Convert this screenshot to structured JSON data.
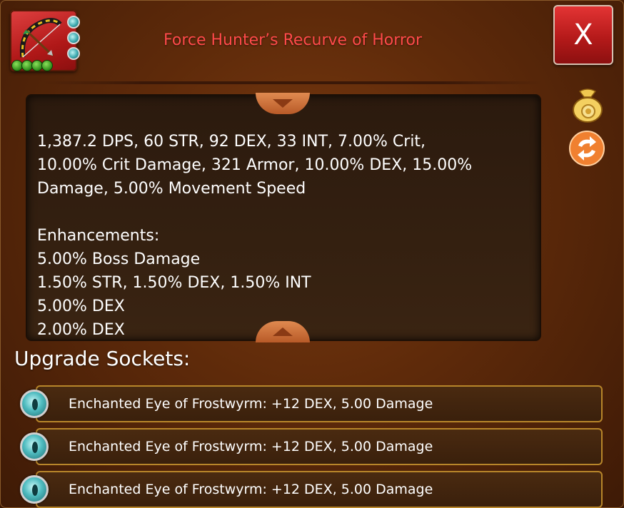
{
  "item": {
    "title": "Force Hunter’s Recurve of Horror",
    "icon": "recurve-bow-icon",
    "socket_gems": 3,
    "level_pips": 4
  },
  "close_button": {
    "label": "X"
  },
  "description": {
    "partial_line": "1,387.2 DPS, 60 STR, 92 DEX, 33 INT, 7.00% Crit,",
    "lines": [
      "10.00% Crit Damage, 321 Armor, 10.00% DEX, 15.00%",
      "Damage, 5.00% Movement Speed",
      "",
      "Enhancements:",
      "5.00% Boss Damage",
      "1.50% STR, 1.50% DEX, 1.50% INT",
      "5.00% DEX",
      "2.00% DEX"
    ]
  },
  "side_actions": [
    {
      "name": "sell-item-icon"
    },
    {
      "name": "swap-item-icon"
    }
  ],
  "sockets": {
    "heading": "Upgrade Sockets:",
    "items": [
      {
        "label": "Enchanted Eye of Frostwyrm: +12 DEX, 5.00 Damage",
        "icon": "frostwyrm-eye-gem-icon"
      },
      {
        "label": "Enchanted Eye of Frostwyrm: +12 DEX, 5.00 Damage",
        "icon": "frostwyrm-eye-gem-icon"
      },
      {
        "label": "Enchanted Eye of Frostwyrm: +12 DEX, 5.00 Damage",
        "icon": "frostwyrm-eye-gem-icon"
      }
    ]
  },
  "colors": {
    "title": "#ff4a4a",
    "close_button": "#c32020",
    "socket_border": "#b8862a",
    "background": "#5e2a0a"
  }
}
